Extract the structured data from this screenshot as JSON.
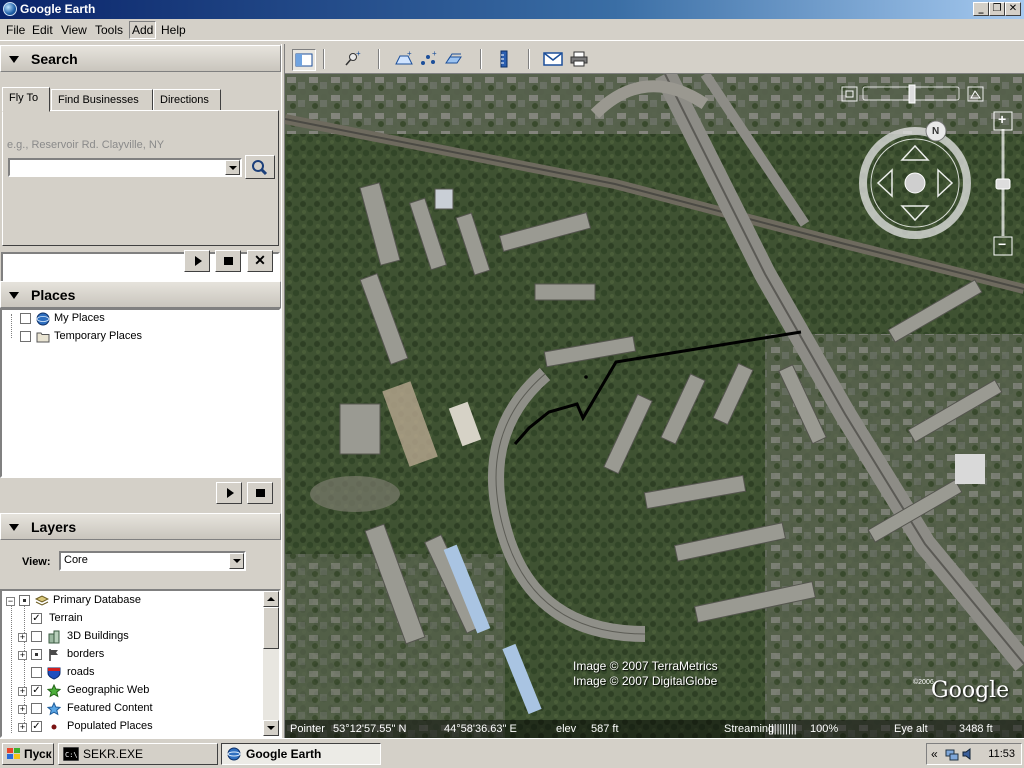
{
  "window": {
    "title": "Google Earth"
  },
  "menu": [
    "File",
    "Edit",
    "View",
    "Tools",
    "Add",
    "Help"
  ],
  "search": {
    "header": "Search",
    "tabs": [
      "Fly To",
      "Find Businesses",
      "Directions"
    ],
    "hint": "e.g., Reservoir Rd. Clayville, NY",
    "value": ""
  },
  "places": {
    "header": "Places",
    "items": [
      "My Places",
      "Temporary Places"
    ]
  },
  "layers": {
    "header": "Layers",
    "view_label": "View:",
    "view_value": "Core",
    "items": [
      "Primary Database",
      "Terrain",
      "3D Buildings",
      "borders",
      "roads",
      "Geographic Web",
      "Featured Content",
      "Populated Places"
    ]
  },
  "map": {
    "credits": [
      "Image © 2007 TerraMetrics",
      "Image © 2007 DigitalGlobe"
    ],
    "logo": "Google",
    "logo_year": "©2006",
    "compass_n": "N"
  },
  "status": {
    "pointer_label": "Pointer",
    "lat": "53°12'57.55\"  N",
    "lon": "44°58'36.63\"  E",
    "elev_label": "elev",
    "elev": "587 ft",
    "streaming_label": "Streaming",
    "streaming_bars": "||||||||||",
    "streaming_pct": "100%",
    "eyealt_label": "Eye alt",
    "eyealt": "3488 ft"
  },
  "taskbar": {
    "start": "Пуск",
    "tasks": [
      "SEKR.EXE",
      "Google Earth"
    ],
    "tray_arrows": "«",
    "clock": "11:53"
  }
}
